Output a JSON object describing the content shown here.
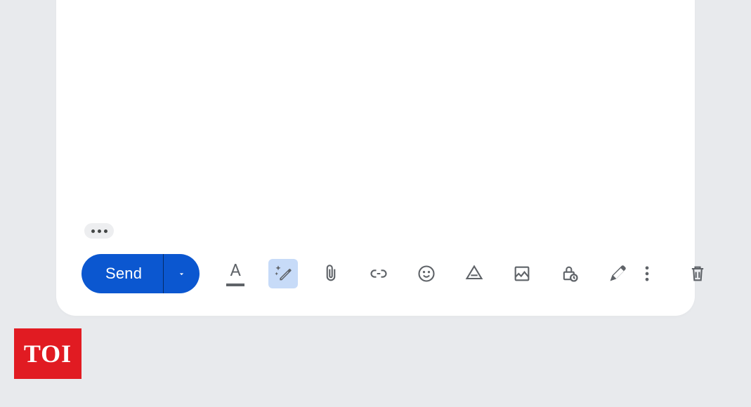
{
  "compose": {
    "body_empty": true,
    "send_label": "Send",
    "toolbar_icons": {
      "formatting": "Formatting options",
      "smart_compose": "Help me write",
      "attach": "Attach files",
      "link": "Insert link",
      "emoji": "Insert emoji",
      "drive": "Insert files using Drive",
      "photo": "Insert photo",
      "confidential": "Toggle confidential mode",
      "signature": "Insert signature",
      "more": "More options",
      "discard": "Discard draft"
    },
    "highlighted_tool": "smart_compose",
    "show_trimmed_label": "Show trimmed content"
  },
  "badge": {
    "text": "TOI"
  },
  "colors": {
    "send_blue": "#0b57d0",
    "highlight_blue": "#c7dbf8",
    "icon_grey": "#5f6368",
    "page_bg": "#e8eaed",
    "toi_red": "#e11b22"
  }
}
